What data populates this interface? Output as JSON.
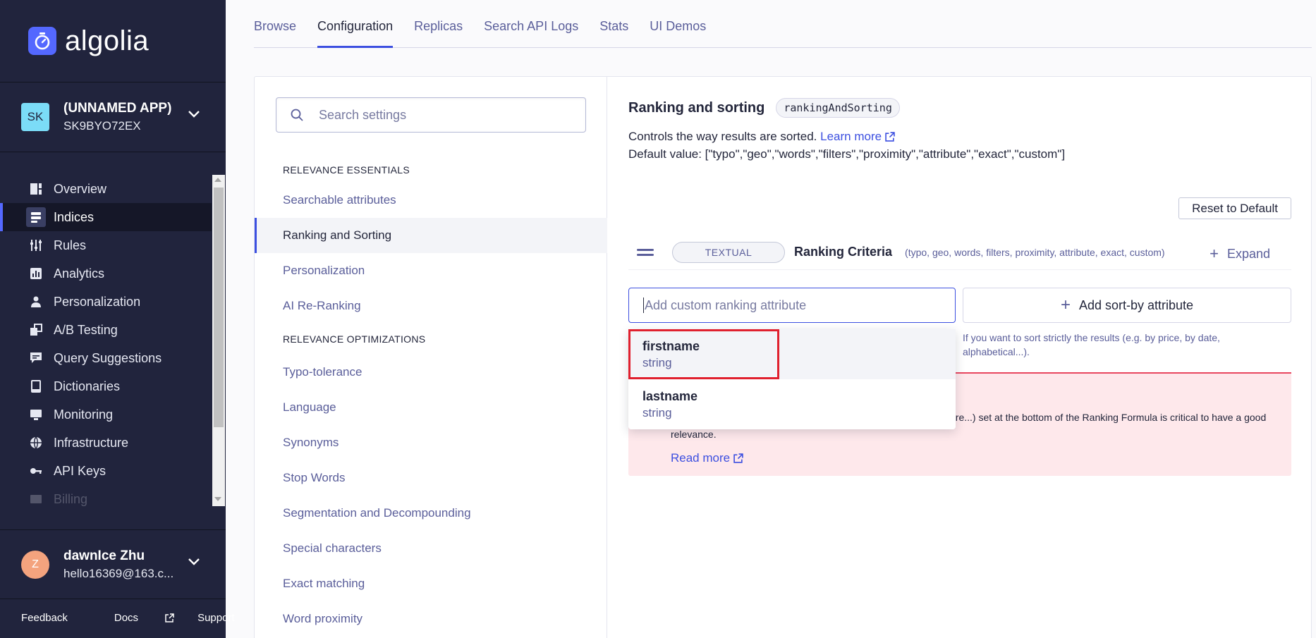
{
  "brand": {
    "name": "algolia",
    "accent": "#5468ff"
  },
  "app": {
    "badge": "SK",
    "name": "(UNNAMED APP)",
    "id": "SK9BYO72EX"
  },
  "nav": {
    "items": [
      {
        "label": "Overview",
        "icon": "overview-icon"
      },
      {
        "label": "Indices",
        "icon": "indices-icon",
        "active": true
      },
      {
        "label": "Rules",
        "icon": "rules-icon"
      },
      {
        "label": "Analytics",
        "icon": "analytics-icon"
      },
      {
        "label": "Personalization",
        "icon": "personalization-icon"
      },
      {
        "label": "A/B Testing",
        "icon": "ab-testing-icon"
      },
      {
        "label": "Query Suggestions",
        "icon": "query-suggestions-icon"
      },
      {
        "label": "Dictionaries",
        "icon": "dictionaries-icon"
      },
      {
        "label": "Monitoring",
        "icon": "monitoring-icon"
      },
      {
        "label": "Infrastructure",
        "icon": "infrastructure-icon"
      },
      {
        "label": "API Keys",
        "icon": "api-keys-icon"
      },
      {
        "label": "Billing",
        "icon": "billing-icon"
      }
    ]
  },
  "user": {
    "initial": "Z",
    "name": "dawnIce Zhu",
    "email": "hello16369@163.c..."
  },
  "footer": {
    "feedback": "Feedback",
    "docs": "Docs",
    "support": "Support"
  },
  "tabs": [
    "Browse",
    "Configuration",
    "Replicas",
    "Search API Logs",
    "Stats",
    "UI Demos"
  ],
  "settings": {
    "search_placeholder": "Search settings",
    "section1": "RELEVANCE ESSENTIALS",
    "essentials": [
      "Searchable attributes",
      "Ranking and Sorting",
      "Personalization",
      "AI Re-Ranking"
    ],
    "section2": "RELEVANCE OPTIMIZATIONS",
    "optimizations": [
      "Typo-tolerance",
      "Language",
      "Synonyms",
      "Stop Words",
      "Segmentation and Decompounding",
      "Special characters",
      "Exact matching",
      "Word proximity"
    ]
  },
  "ranking": {
    "title": "Ranking and sorting",
    "code": "rankingAndSorting",
    "description": "Controls the way results are sorted.",
    "learn_more": "Learn more",
    "default_value": "Default value: [\"typo\",\"geo\",\"words\",\"filters\",\"proximity\",\"attribute\",\"exact\",\"custom\"]",
    "reset": "Reset to Default",
    "criteria_badge": "TEXTUAL",
    "criteria_name": "Ranking Criteria",
    "criteria_list": "(typo, geo, words, filters, proximity, attribute, exact, custom)",
    "expand": "Expand",
    "custom_placeholder": "Add custom ranking attribute",
    "sortby_label": "Add sort-by attribute",
    "sortby_hint": "If you want to sort strictly the results (e.g. by price, by date, alphabetical...).",
    "warning_text": "score...) set at the bottom of the Ranking Formula is critical to have a good relevance.",
    "warning_link": "Read more"
  },
  "dropdown": [
    {
      "name": "firstname",
      "type": "string"
    },
    {
      "name": "lastname",
      "type": "string"
    }
  ]
}
